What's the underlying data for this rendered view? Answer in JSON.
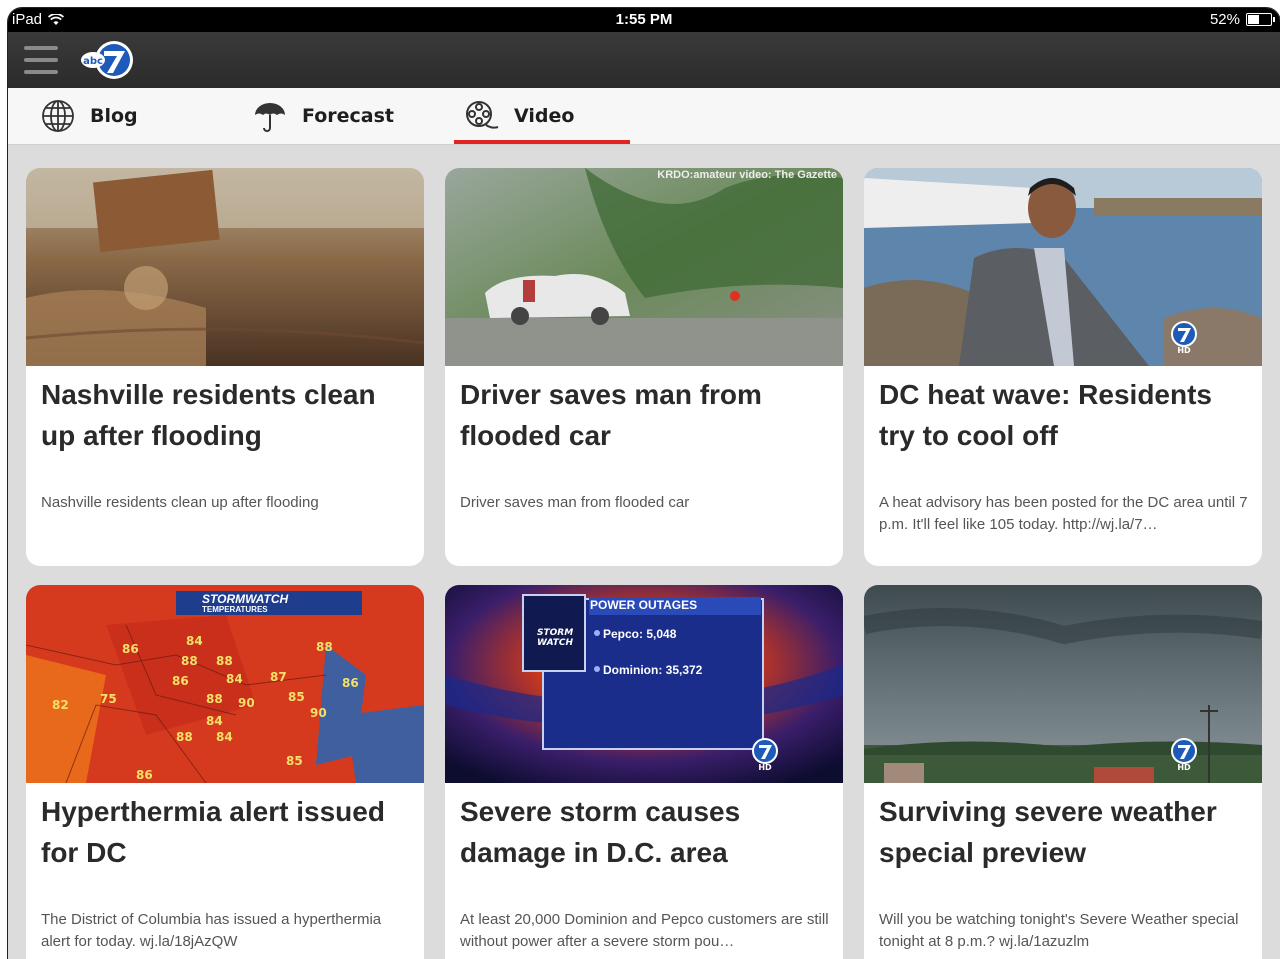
{
  "status": {
    "carrier": "iPad",
    "time": "1:55 PM",
    "battery": "52%",
    "battery_level": 0.52
  },
  "app": {
    "logo_text": "abc",
    "logo_number": "7"
  },
  "tabs": [
    {
      "label": "Blog",
      "icon": "globe-icon"
    },
    {
      "label": "Forecast",
      "icon": "umbrella-icon"
    },
    {
      "label": "Video",
      "icon": "film-reel-icon",
      "active": true
    }
  ],
  "cards": [
    {
      "title": "Nashville residents clean up after flooding",
      "desc": "Nashville residents clean up after flooding"
    },
    {
      "title": "Driver saves man from flooded car",
      "desc": "Driver saves man from flooded car",
      "overlay": "KRDO:amateur video: The Gazette"
    },
    {
      "title": "DC heat wave: Residents try to cool off",
      "desc": "A heat advisory has been posted for the DC area until 7 p.m. It'll feel like 105 today. http://wj.la/7…"
    },
    {
      "title": "Hyperthermia alert issued for DC",
      "desc": "The District of Columbia has issued a hyperthermia alert for today. wj.la/18jAzQW",
      "overlay": "STORMWATCH",
      "overlay_sub": "TEMPERATURES"
    },
    {
      "title": "Severe storm causes damage in D.C. area",
      "desc": "At least 20,000 Dominion and Pepco customers are still without power after a severe storm pou…",
      "overlay": "POWER OUTAGES",
      "line1": "Pepco: 5,048",
      "line2": "Dominion: 35,372"
    },
    {
      "title": "Surviving severe weather special preview",
      "desc": "Will you be watching tonight's Severe Weather special tonight at 8 p.m.? wj.la/1azuzlm"
    }
  ],
  "colors": {
    "accent": "#e32322",
    "appbar": "#333333",
    "background": "#dcdcdc"
  }
}
